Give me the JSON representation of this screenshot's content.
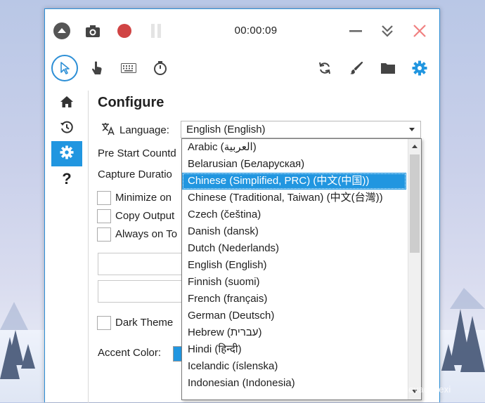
{
  "colors": {
    "accent": "#2196e0",
    "record": "#d04444",
    "close": "#f08080",
    "icon": "#444444"
  },
  "titlebar": {
    "timer": "00:00:09",
    "icons": [
      "expand-up-icon",
      "camera-icon",
      "record-icon",
      "pause-icon",
      "minimize-icon",
      "collapse-down-icon",
      "close-icon"
    ]
  },
  "toolbar": {
    "icons": [
      "cursor-icon",
      "hand-pointer-icon",
      "keyboard-icon",
      "stopwatch-icon",
      "refresh-icon",
      "brush-icon",
      "folder-icon",
      "gear-icon"
    ]
  },
  "sidebar": {
    "items": [
      {
        "icon": "home-icon"
      },
      {
        "icon": "history-icon"
      },
      {
        "icon": "gear-icon",
        "active": true
      },
      {
        "icon": "help-icon",
        "label": "?"
      }
    ]
  },
  "configure": {
    "title": "Configure",
    "language_label": "Language:",
    "language_value": "English (English)",
    "pre_start_label": "Pre Start Countd",
    "capture_duration_label": "Capture Duratio",
    "minimize_label": "Minimize on",
    "copy_output_label": "Copy Output",
    "always_on_top_label": "Always on To",
    "dark_theme_label": "Dark Theme",
    "accent_color_label": "Accent Color:"
  },
  "language_options": [
    "Arabic (العربية)",
    "Belarusian (Беларуская)",
    "Chinese (Simplified, PRC) (中文(中国))",
    "Chinese (Traditional, Taiwan) (中文(台灣))",
    "Czech (čeština)",
    "Danish (dansk)",
    "Dutch (Nederlands)",
    "English (English)",
    "Finnish (suomi)",
    "French (français)",
    "German (Deutsch)",
    "Hebrew (עברית)",
    "Hindi (हिन्दी)",
    "Icelandic (íslenska)",
    "Indonesian (Indonesia)"
  ],
  "selected_language_index": 2,
  "watermark": "https://blog.csdn.net/xiaoxueyaoxuexi"
}
